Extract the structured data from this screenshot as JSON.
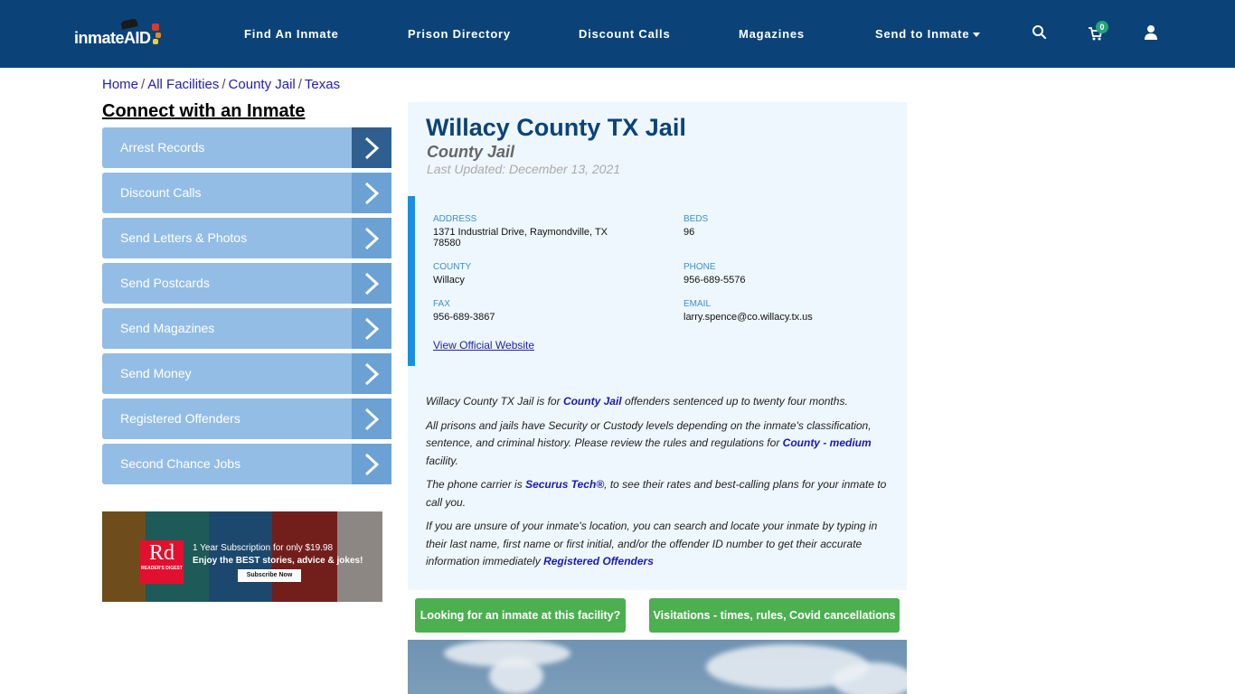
{
  "nav": {
    "logo_text": "inmate",
    "logo_aid": "AID",
    "links": [
      "Find An Inmate",
      "Prison Directory",
      "Discount Calls",
      "Magazines",
      "Send to Inmate"
    ],
    "cart_count": "0",
    "icons": [
      "search-icon",
      "cart-icon",
      "user-icon"
    ]
  },
  "breadcrumb": [
    "Home",
    "All Facilities",
    "County Jail",
    "Texas"
  ],
  "sidebar": {
    "title": "Connect with an Inmate",
    "items": [
      {
        "label": "Arrest Records"
      },
      {
        "label": "Discount Calls"
      },
      {
        "label": "Send Letters & Photos"
      },
      {
        "label": "Send Postcards"
      },
      {
        "label": "Send Magazines"
      },
      {
        "label": "Send Money"
      },
      {
        "label": "Registered Offenders"
      },
      {
        "label": "Second Chance Jobs"
      }
    ],
    "ad": {
      "logo": "Rd",
      "logo_sub": "READER'S DIGEST",
      "line1": "1 Year Subscription for only $19.98",
      "line2": "Enjoy the BEST stories, advice & jokes!",
      "button": "Subscribe Now"
    }
  },
  "facility": {
    "title": "Willacy County TX Jail",
    "type": "County Jail",
    "updated": "Last Updated: December 13, 2021",
    "address_label": "ADDRESS",
    "address": "1371 Industrial Drive, Raymondville, TX",
    "zip": "78580",
    "beds_label": "BEDS",
    "beds": "96",
    "county_label": "COUNTY",
    "county": "Willacy",
    "phone_label": "PHONE",
    "phone": "956-689-5576",
    "fax_label": "FAX",
    "fax": "956-689-3867",
    "email_label": "EMAIL",
    "email": "larry.spence@co.willacy.tx.us",
    "website_link": "View Official Website"
  },
  "description": {
    "p1_a": "Willacy County TX Jail is for ",
    "p1_link": "County Jail",
    "p1_b": " offenders sentenced up to twenty four months.",
    "p2_a": "All prisons and jails have Security or Custody levels depending on the inmate's classification, sentence, and criminal history. Please review the rules and regulations for ",
    "p2_link": "County - medium",
    "p2_b": " facility.",
    "p3_a": "The phone carrier is ",
    "p3_link": "Securus Tech®",
    "p3_b": ", to see their rates and best-calling plans for your inmate to call you.",
    "p4_a": "If you are unsure of your inmate's location, you can search and locate your inmate by typing in their last name, first name or first initial, and/or the offender ID number to get their accurate information immediately ",
    "p4_link": "Registered Offenders"
  },
  "buttons": {
    "find_inmate": "Looking for an inmate at this facility?",
    "visitations": "Visitations - times, rules, Covid cancellations"
  },
  "colors": {
    "nav_bg": "#0b4379",
    "sidebar_item": "#93bde5",
    "button_green": "#4caf50",
    "accent_blue": "#1a8fe3"
  }
}
